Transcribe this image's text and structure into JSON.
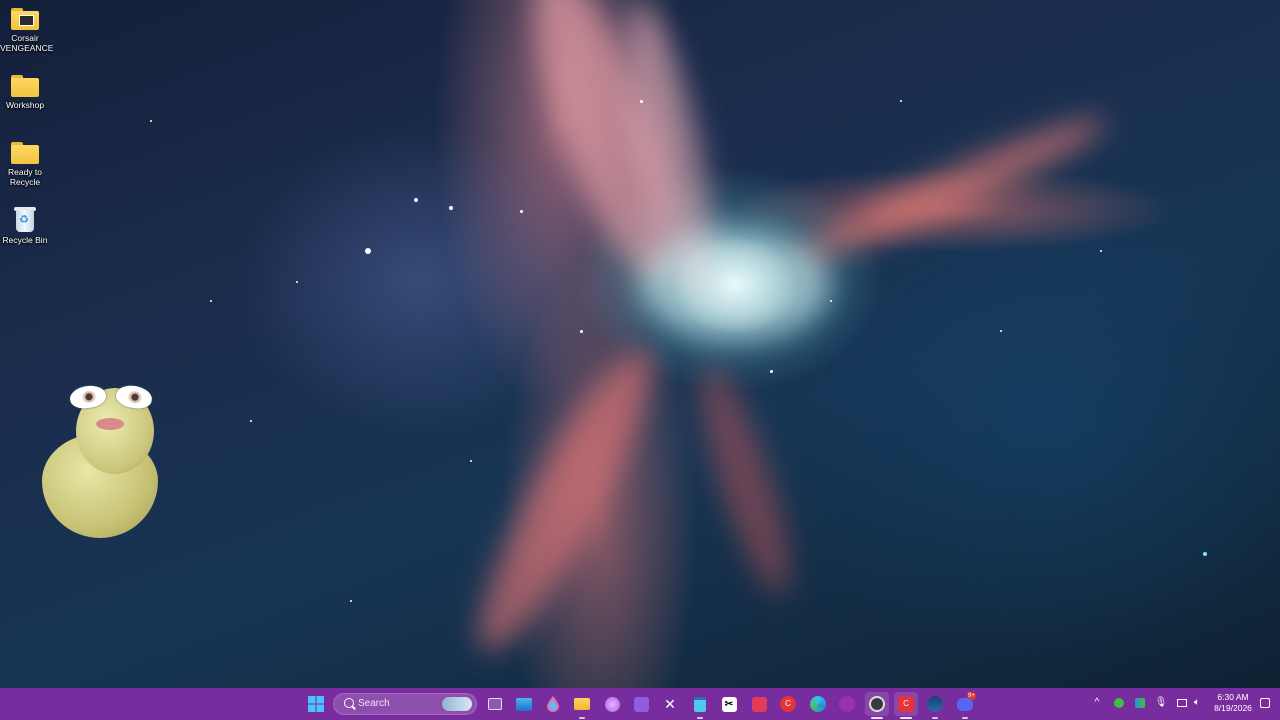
{
  "desktop": {
    "icons": [
      {
        "label": "Corsair VENGEANCE",
        "type": "folder-image-icon"
      },
      {
        "label": "Workshop",
        "type": "folder-icon"
      },
      {
        "label": "Ready to Recycle",
        "type": "folder-icon"
      },
      {
        "label": "Recycle Bin",
        "type": "recycle-bin-icon"
      }
    ],
    "wallpaper": "space nebula",
    "widget": "duck-figurine-sticker"
  },
  "taskbar": {
    "color": "#782d9e",
    "start_icon": "windows-start-icon",
    "search_placeholder": "Search",
    "pinned": [
      "task-view-icon",
      "photos-icon",
      "droplet-app-icon",
      "file-explorer-icon",
      "copilot-icon",
      "app-grid-icon",
      "capcut-x-icon",
      "notepad-icon",
      "capcut-icon",
      "red-app-icon",
      "canva-red-icon",
      "edge-icon",
      "purple-app-icon",
      "obs-icon",
      "canva-active-icon",
      "steam-icon",
      "discord-icon"
    ],
    "discord_badge": "9+",
    "tray": [
      "chevron-up-icon",
      "green-shield-icon",
      "defender-icon",
      "microphone-icon",
      "display-icon",
      "volume-icon"
    ],
    "clock": {
      "time": "6:30 AM",
      "date": "8/19/2026"
    }
  }
}
